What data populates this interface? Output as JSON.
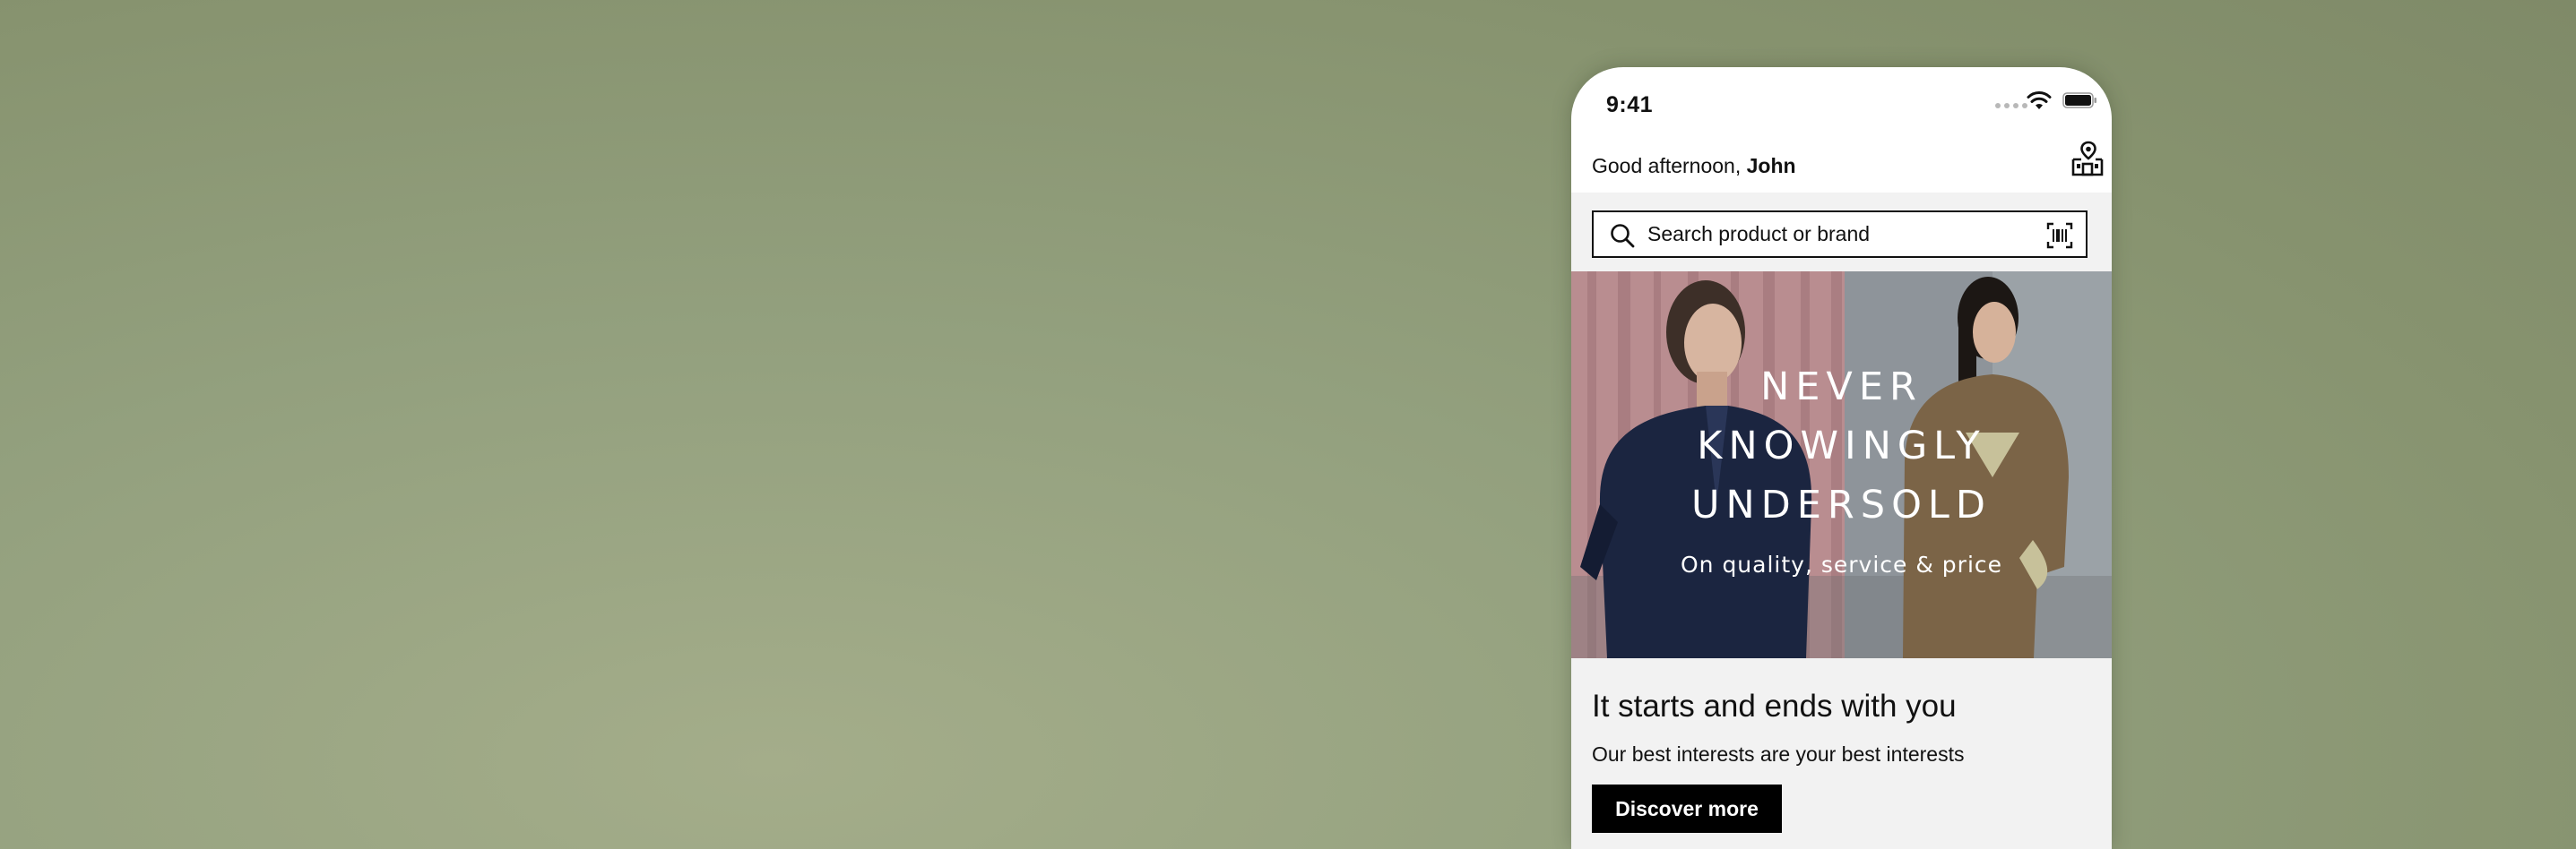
{
  "status_bar": {
    "time": "9:41"
  },
  "header": {
    "greeting_prefix": "Good afternoon,",
    "user_name": "John",
    "store_icon": "store-locator-icon"
  },
  "search": {
    "placeholder": "Search product or brand",
    "search_icon": "search-icon",
    "barcode_icon": "barcode-scan-icon"
  },
  "hero": {
    "title_lines": [
      "NEVER",
      "KNOWINGLY",
      "UNDERSOLD"
    ],
    "subtitle": "On quality, service & price"
  },
  "promo": {
    "heading": "It starts and ends with you",
    "text": "Our best interests are your best interests",
    "button_label": "Discover more"
  },
  "colors": {
    "background": "#87936f",
    "button": "#000000",
    "promo_bg": "#f2f2f2"
  }
}
